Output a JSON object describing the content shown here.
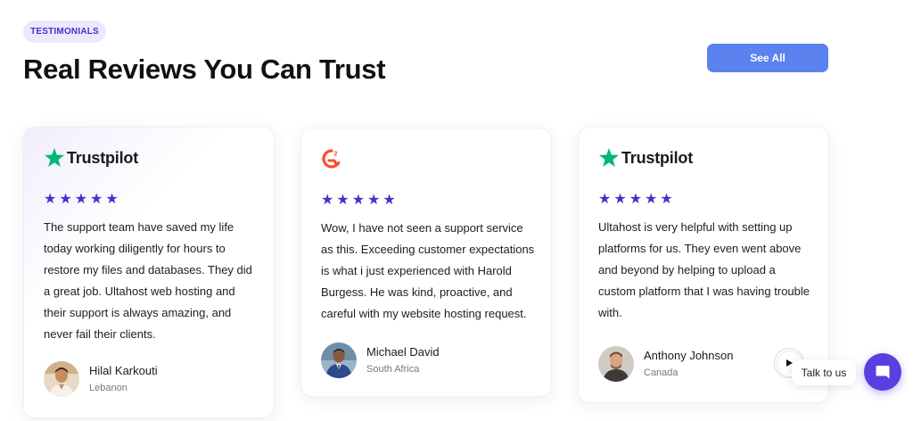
{
  "section": {
    "badge": "TESTIMONIALS",
    "title": "Real Reviews You Can Trust",
    "see_all_label": "See All"
  },
  "colors": {
    "accent": "#5b82ee",
    "star": "#4b2fc9",
    "trustpilot_green": "#00b67a",
    "g2_red": "#ff492c",
    "chat_button": "#5b3ee0"
  },
  "testimonials": [
    {
      "platform": "Trustpilot",
      "logo_icon": "trustpilot-logo-icon",
      "rating": 5,
      "text": "The support team have saved my life today working diligently for hours to restore my files and databases. They did a great job. Ultahost web hosting and their support is always amazing, and never fail their clients.",
      "name": "Hilal Karkouti",
      "location": "Lebanon"
    },
    {
      "platform": "G2",
      "logo_icon": "g2-logo-icon",
      "rating": 5,
      "text": "Wow, I have not seen a support service as this. Exceeding customer expectations is what i just experienced with Harold Burgess. He was kind, proactive, and careful with my website hosting request.",
      "name": "Michael David",
      "location": "South Africa"
    },
    {
      "platform": "Trustpilot",
      "logo_icon": "trustpilot-logo-icon",
      "rating": 5,
      "text": "Ultahost is very helpful with setting up platforms for us. They even went above and beyond by helping to upload a custom platform that I was having trouble with.",
      "name": "Anthony Johnson",
      "location": "Canada"
    }
  ],
  "chat_widget": {
    "tooltip": "Talk to us"
  }
}
